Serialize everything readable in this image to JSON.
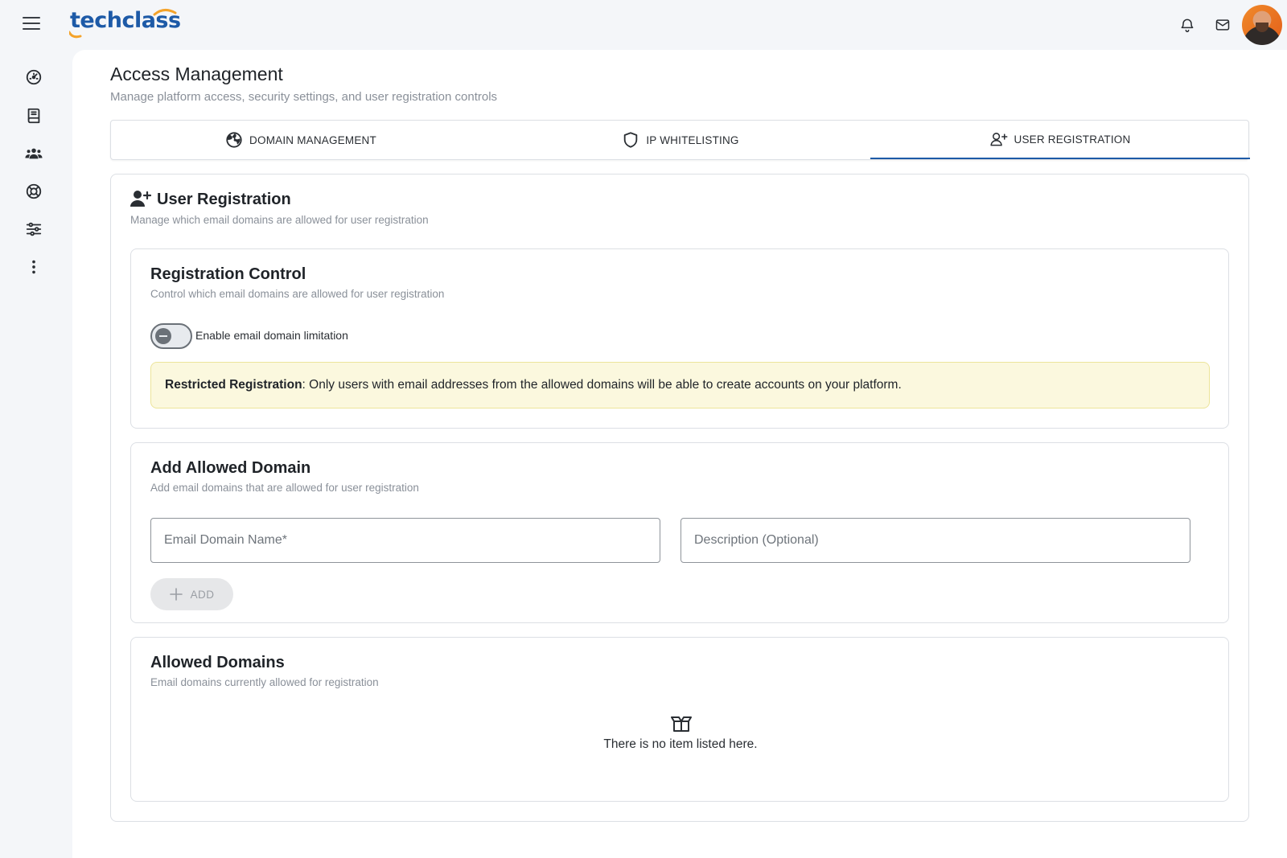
{
  "app": {
    "logo_text": "techclass",
    "brand_color": "#1d5aa7",
    "accent_color": "#f4a32a"
  },
  "topbar": {
    "menu_icon": "hamburger-menu-icon",
    "notification_icon": "bell-icon",
    "mail_icon": "mail-icon",
    "avatar": "user-avatar"
  },
  "sidebar": {
    "items": [
      {
        "icon": "dashboard-gauge-icon"
      },
      {
        "icon": "book-icon"
      },
      {
        "icon": "users-group-icon"
      },
      {
        "icon": "lifebuoy-icon"
      },
      {
        "icon": "sliders-icon"
      },
      {
        "icon": "more-vertical-icon"
      }
    ]
  },
  "page": {
    "title": "Access Management",
    "subtitle": "Manage platform access, security settings, and user registration controls"
  },
  "tabs": [
    {
      "label": "DOMAIN MANAGEMENT",
      "icon": "globe-icon",
      "active": false
    },
    {
      "label": "IP WHITELISTING",
      "icon": "shield-icon",
      "active": false
    },
    {
      "label": "USER REGISTRATION",
      "icon": "user-plus-icon",
      "active": true
    }
  ],
  "section": {
    "title": "User Registration",
    "subtitle": "Manage which email domains are allowed for user registration"
  },
  "registration_control": {
    "title": "Registration Control",
    "subtitle": "Control which email domains are allowed for user registration",
    "toggle_label": "Enable email domain limitation",
    "toggle_on": false,
    "alert_bold": "Restricted Registration",
    "alert_text": ": Only users with email addresses from the allowed domains will be able to create accounts on your platform."
  },
  "add_domain": {
    "title": "Add Allowed Domain",
    "subtitle": "Add email domains that are allowed for user registration",
    "domain_placeholder": "Email Domain Name*",
    "domain_value": "",
    "description_placeholder": "Description (Optional)",
    "description_value": "",
    "add_label": "ADD"
  },
  "allowed_domains": {
    "title": "Allowed Domains",
    "subtitle": "Email domains currently allowed for registration",
    "empty_text": "There is no item listed here.",
    "empty_icon": "empty-box-icon"
  }
}
